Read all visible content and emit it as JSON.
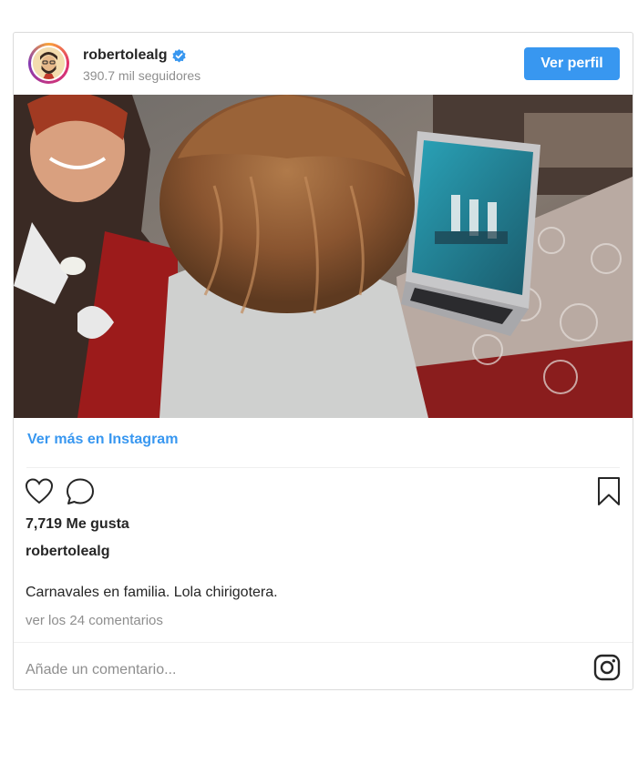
{
  "header": {
    "username": "robertolealg",
    "followers": "390.7 mil seguidores",
    "follow_label": "Ver perfil"
  },
  "post": {
    "view_more_label": "Ver más en Instagram",
    "likes": "7,719 Me gusta",
    "author": "robertolealg",
    "caption": "Carnavales en familia. Lola chirigotera.",
    "comments_link": "ver los 24 comentarios",
    "comment_placeholder": "Añade un comentario..."
  },
  "icons": {
    "verified": "verified-badge-icon",
    "like": "heart-icon",
    "comment": "comment-bubble-icon",
    "save": "bookmark-icon",
    "brand": "instagram-icon"
  },
  "colors": {
    "accent": "#3897f0",
    "text": "#262626",
    "muted": "#8e8e8e",
    "border": "#dbdbdb"
  }
}
